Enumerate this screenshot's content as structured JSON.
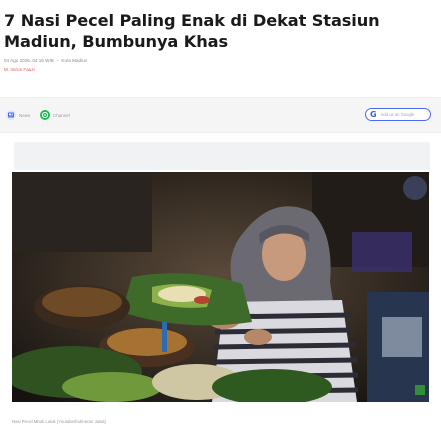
{
  "article": {
    "title": "7 Nasi Pecel Paling Enak di Dekat Stasiun Madiun, Bumbunya Khas",
    "date": "04 Agu 2026, 04:16 WIB",
    "location": "Kota Madiun",
    "author": "M. Imron Fauzi"
  },
  "share_bar": {
    "news_label": "News",
    "channel_label": "Channel",
    "google_button_label": "Add us on Google",
    "google_icon_text": "G",
    "accent_color": "#4a6cf7"
  },
  "photo": {
    "caption": "Nasi Pecel Mbok Luluk (Youtube/Kulineran Jawa)"
  }
}
